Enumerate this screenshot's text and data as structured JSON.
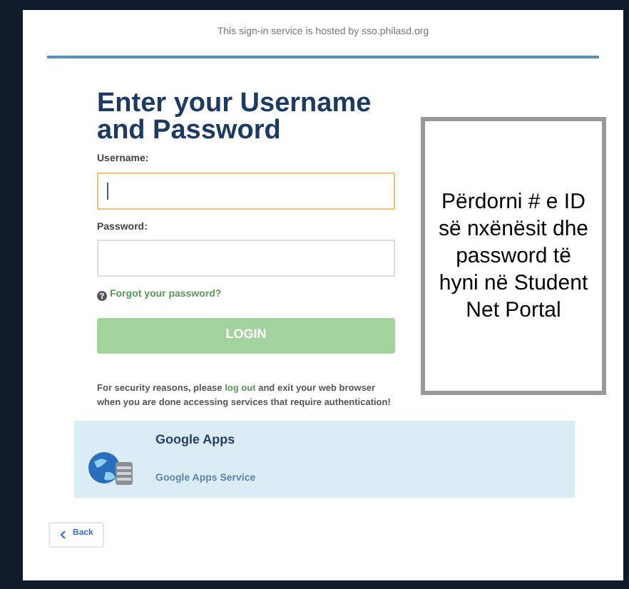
{
  "header": {
    "text": "This sign-in service is hosted by sso.philasd.org"
  },
  "form": {
    "title": "Enter your Username and Password",
    "fields": [
      {
        "label": "Username:",
        "focused": true
      },
      {
        "label": "Password:",
        "focused": false
      }
    ],
    "forgot_link": "Forgot your password?",
    "login_button": {
      "label": "LOGIN",
      "disabled": true
    },
    "security_note": {
      "before": "For security reasons, please ",
      "link": "log out",
      "after": " and exit your web browser when you are done accessing services that require authentication!"
    }
  },
  "service_card": {
    "title": "Google Apps",
    "subtitle": "Google Apps Service"
  },
  "back_button": {
    "label": "Back"
  },
  "overlay_note": "Përdorni # e ID së nxënësit dhe password të hyni në Student Net Portal"
}
